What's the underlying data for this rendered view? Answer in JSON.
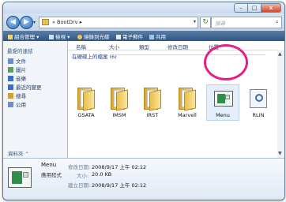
{
  "window": {
    "buttons": [
      "–",
      "□",
      "x"
    ]
  },
  "address": {
    "nav_back": "◀",
    "nav_forward": "▶",
    "nav_dropdown": "▾",
    "path": "« BootDrv ▸",
    "dropdown": "▾",
    "refresh": "↻",
    "search_placeholder": "搜尋",
    "search_icon": "⌕"
  },
  "commands": {
    "organize": "組合管理 ▾",
    "views": "檢視 ▾",
    "burn": "燒錄到光碟",
    "email": "電子郵件",
    "share": "共用"
  },
  "navpane": {
    "title": "最愛的連結",
    "items": [
      {
        "label": "文件",
        "color": "#6a8fc7"
      },
      {
        "label": "圖片",
        "color": "#5ba05b"
      },
      {
        "label": "音樂",
        "color": "#3a6fc4"
      },
      {
        "label": "最近的變更",
        "color": "#3a6fc4"
      },
      {
        "label": "搜尋",
        "color": "#d0a030"
      },
      {
        "label": "公用",
        "color": "#6a8fc7"
      }
    ],
    "folders_label": "資料夾",
    "folders_chevron": "⌃"
  },
  "columns": [
    "名稱",
    "大小",
    "類型",
    "修改日期",
    "位置"
  ],
  "group": {
    "title": "在硬碟上的檔案 (6)"
  },
  "items": [
    {
      "label": "GSATA",
      "kind": "folder"
    },
    {
      "label": "IMSM",
      "kind": "folder"
    },
    {
      "label": "IRST",
      "kind": "folder"
    },
    {
      "label": "Marvell",
      "kind": "folder"
    },
    {
      "label": "Menu",
      "kind": "app"
    },
    {
      "label": "RLIN",
      "kind": "doc"
    }
  ],
  "scrollbar": {
    "up": "▲",
    "down": "▼"
  },
  "details": {
    "name": "Menu",
    "type": "應用程式",
    "modified_label": "修改日期:",
    "modified_value": "2008/9/17 上午 02:12",
    "size_label": "大小:",
    "size_value": "20.0 KB",
    "created_label": "建立日期:",
    "created_value": "2008/9/17 上午 02:12"
  },
  "colors": {
    "highlight_circle": "#e2208a"
  }
}
